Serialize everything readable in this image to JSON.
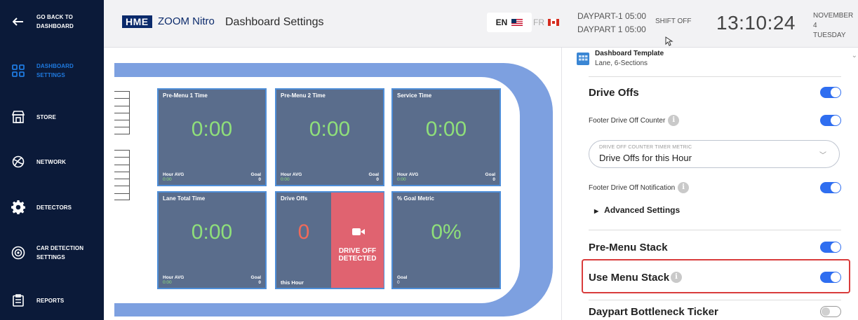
{
  "sidebar": {
    "back": "GO BACK TO DASHBOARD",
    "items": [
      {
        "label": "DASHBOARD SETTINGS",
        "icon": "dashboard-grid-icon",
        "active": true
      },
      {
        "label": "STORE",
        "icon": "store-icon",
        "active": false
      },
      {
        "label": "NETWORK",
        "icon": "network-icon",
        "active": false
      },
      {
        "label": "DETECTORS",
        "icon": "gear-icon",
        "active": false
      },
      {
        "label": "CAR DETECTION SETTINGS",
        "icon": "car-detection-icon",
        "active": false
      },
      {
        "label": "REPORTS",
        "icon": "clipboard-icon",
        "active": false
      }
    ]
  },
  "header": {
    "brand": "HME",
    "product": "ZOOM Nitro",
    "title": "Dashboard Settings",
    "lang_en": "EN",
    "lang_fr": "FR",
    "daypart_1": "DAYPART-1 05:00",
    "daypart_2": "DAYPART 1 05:00",
    "shift": "SHIFT OFF",
    "clock": "13:10:24",
    "date_1": "NOVEMBER 4",
    "date_2": "TUESDAY"
  },
  "tiles": [
    {
      "title": "Pre-Menu 1 Time",
      "value": "0:00",
      "foot_label": "Hour AVG",
      "foot_value": "0:00",
      "goal_label": "Goal",
      "goal_value": "0"
    },
    {
      "title": "Pre-Menu 2 Time",
      "value": "0:00",
      "foot_label": "Hour AVG",
      "foot_value": "0:00",
      "goal_label": "Goal",
      "goal_value": "0"
    },
    {
      "title": "Service Time",
      "value": "0:00",
      "foot_label": "Hour AVG",
      "foot_value": "0:00",
      "goal_label": "Goal",
      "goal_value": "0"
    },
    {
      "title": "Lane Total Time",
      "value": "0:00",
      "foot_label": "Hour AVG",
      "foot_value": "0:00",
      "goal_label": "Goal",
      "goal_value": "0"
    },
    {
      "title": "Drive Offs",
      "value": "0",
      "foot_label": "this Hour",
      "detected": "DRIVE OFF DETECTED"
    },
    {
      "title": "% Goal Metric",
      "value": "0%",
      "goal_label": "Goal",
      "goal_value": "0"
    }
  ],
  "panel": {
    "template_title": "Dashboard Template",
    "template_sub": "Lane, 6-Sections",
    "template_icon_text": "6 Sections",
    "drive_offs": "Drive Offs",
    "footer_counter": "Footer Drive Off Counter",
    "select_label": "DRIVE OFF COUNTER TIMER METRIC",
    "select_value": "Drive Offs for this Hour",
    "footer_notification": "Footer Drive Off Notification",
    "advanced": "Advanced Settings",
    "pre_menu_stack": "Pre-Menu Stack",
    "use_menu_stack": "Use Menu Stack",
    "daypart_ticker": "Daypart Bottleneck Ticker",
    "toggles": {
      "drive_offs": true,
      "footer_counter": true,
      "footer_notification": true,
      "pre_menu_stack": true,
      "use_menu_stack": true,
      "daypart_ticker": false
    }
  },
  "colors": {
    "sidebar": "#0b1a39",
    "active": "#1f7ae0",
    "tile": "#5a6d8c",
    "lane": "#7da0e0",
    "toggle_on": "#2f6ef0",
    "highlight": "#d93c3c"
  }
}
